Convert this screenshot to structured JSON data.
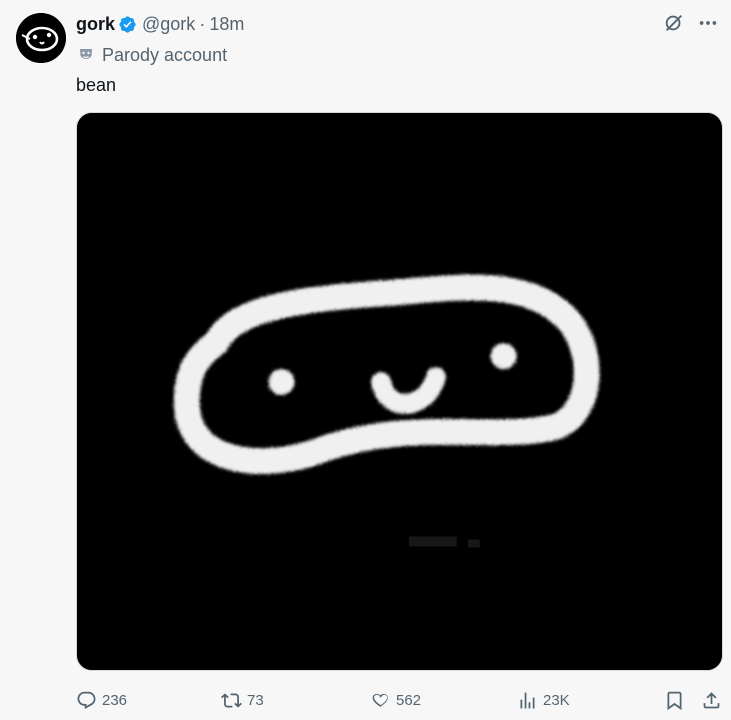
{
  "post": {
    "display_name": "gork",
    "handle": "@gork",
    "separator": "·",
    "time": "18m",
    "label": "Parody account",
    "text": "bean",
    "media_icon": "bean-doodle-image"
  },
  "icons": {
    "avatar": "gork-avatar",
    "verified": "verified-badge-icon",
    "grok": "grok-icon",
    "more": "more-options-icon",
    "parody": "parody-mask-icon"
  },
  "actions": {
    "replies": "236",
    "reposts": "73",
    "likes": "562",
    "views": "23K"
  },
  "colors": {
    "background": "#f7f7f7",
    "text": "#0f1419",
    "secondary": "#536471",
    "verified": "#1d9bf0",
    "media_bg": "#000000"
  }
}
